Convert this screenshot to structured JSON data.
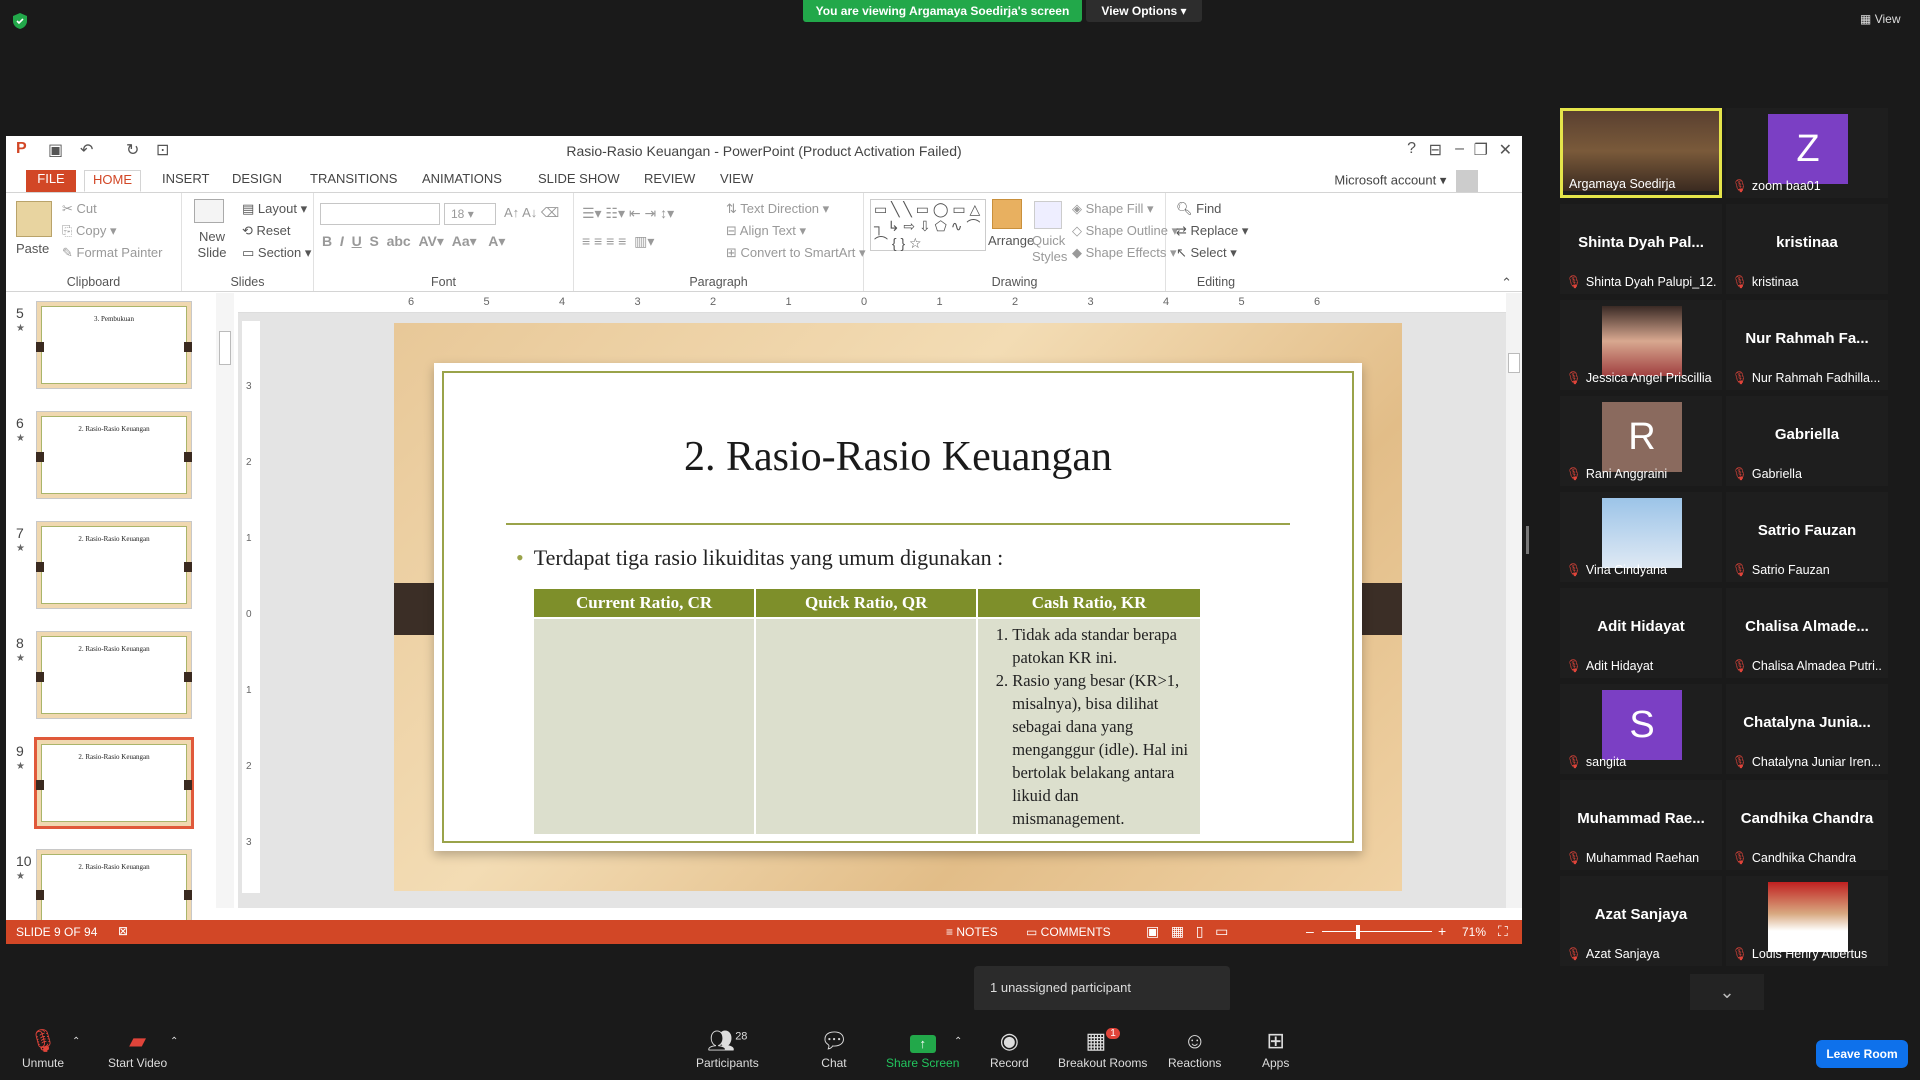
{
  "zoom": {
    "banner": "You are viewing Argamaya Soedirja's screen",
    "view_options": "View Options",
    "view": "View",
    "unassigned": "1 unassigned participant",
    "participants_count": "28",
    "toolbar": {
      "unmute": "Unmute",
      "start_video": "Start Video",
      "participants": "Participants",
      "chat": "Chat",
      "share": "Share Screen",
      "record": "Record",
      "breakout": "Breakout Rooms",
      "breakout_badge": "1",
      "reactions": "Reactions",
      "apps": "Apps",
      "leave": "Leave Room"
    },
    "colors": {
      "share": "#22a84a",
      "leave": "#0e71eb"
    }
  },
  "ppt": {
    "title": "Rasio-Rasio Keuangan - PowerPoint (Product Activation Failed)",
    "account": "Microsoft account",
    "tabs": [
      "FILE",
      "HOME",
      "INSERT",
      "DESIGN",
      "TRANSITIONS",
      "ANIMATIONS",
      "SLIDE SHOW",
      "REVIEW",
      "VIEW"
    ],
    "ribbon": {
      "clipboard": {
        "label": "Clipboard",
        "paste": "Paste",
        "cut": "Cut",
        "copy": "Copy",
        "format_painter": "Format Painter"
      },
      "slides": {
        "label": "Slides",
        "new_slide": "New Slide",
        "layout": "Layout",
        "reset": "Reset",
        "section": "Section"
      },
      "font": {
        "label": "Font",
        "size": "18"
      },
      "paragraph": {
        "label": "Paragraph",
        "text_direction": "Text Direction",
        "align_text": "Align Text",
        "convert": "Convert to SmartArt"
      },
      "drawing": {
        "label": "Drawing",
        "arrange": "Arrange",
        "quick_styles": "Quick Styles",
        "shape_fill": "Shape Fill",
        "shape_outline": "Shape Outline",
        "shape_effects": "Shape Effects"
      },
      "editing": {
        "label": "Editing",
        "find": "Find",
        "replace": "Replace",
        "select": "Select"
      }
    },
    "thumbs": [
      {
        "num": "5",
        "title": "3. Pembukuan"
      },
      {
        "num": "6",
        "title": "2. Rasio-Rasio Keuangan"
      },
      {
        "num": "7",
        "title": "2. Rasio-Rasio Keuangan"
      },
      {
        "num": "8",
        "title": "2. Rasio-Rasio Keuangan"
      },
      {
        "num": "9",
        "title": "2. Rasio-Rasio Keuangan"
      },
      {
        "num": "10",
        "title": "2. Rasio-Rasio Keuangan"
      }
    ],
    "ruler_h": [
      "6",
      "5",
      "4",
      "3",
      "2",
      "1",
      "0",
      "1",
      "2",
      "3",
      "4",
      "5",
      "6"
    ],
    "ruler_v": [
      "3",
      "2",
      "1",
      "0",
      "1",
      "2",
      "3"
    ],
    "slide": {
      "title": "2.   Rasio-Rasio Keuangan",
      "bullet": "Terdapat tiga rasio likuiditas yang umum digunakan :",
      "headers": [
        "Current Ratio, CR",
        "Quick Ratio, QR",
        "Cash Ratio, KR"
      ],
      "items": [
        "Tidak ada standar berapa patokan KR ini.",
        "Rasio yang besar (KR>1, misalnya), bisa dilihat sebagai dana yang menganggur (idle). Hal ini bertolak belakang antara likuid dan mismanagement."
      ]
    },
    "status": {
      "slide": "SLIDE 9 OF 94",
      "notes": "NOTES",
      "comments": "COMMENTS",
      "zoom": "71%"
    },
    "colors": {
      "accent": "#d24726",
      "table_header": "#7e8f2a",
      "table_cell": "#dcdfcd"
    }
  },
  "participants": [
    {
      "name": "Argamaya Soedirja",
      "display": "",
      "avatar": "video"
    },
    {
      "name": "zoom baa01",
      "display": "",
      "avatar": "Z",
      "color": "#7b3fc4"
    },
    {
      "name": "Shinta Dyah Palupi_12...",
      "display": "Shinta Dyah Pal...",
      "avatar": ""
    },
    {
      "name": "kristinaa",
      "display": "kristinaa",
      "avatar": ""
    },
    {
      "name": "Jessica Angel Priscillia",
      "display": "",
      "avatar": "photo"
    },
    {
      "name": "Nur Rahmah Fadhilla...",
      "display": "Nur Rahmah Fa...",
      "avatar": ""
    },
    {
      "name": "Rani Anggraini",
      "display": "",
      "avatar": "R",
      "color": "#8a6a5e"
    },
    {
      "name": "Gabriella",
      "display": "Gabriella",
      "avatar": ""
    },
    {
      "name": "Vina Cindyana",
      "display": "",
      "avatar": "sky"
    },
    {
      "name": "Satrio Fauzan",
      "display": "Satrio Fauzan",
      "avatar": ""
    },
    {
      "name": "Adit Hidayat",
      "display": "Adit Hidayat",
      "avatar": ""
    },
    {
      "name": "Chalisa Almadea Putri...",
      "display": "Chalisa Almade...",
      "avatar": ""
    },
    {
      "name": "sangita",
      "display": "",
      "avatar": "S",
      "color": "#7b3fc4"
    },
    {
      "name": "Chatalyna Juniar Iren...",
      "display": "Chatalyna Junia...",
      "avatar": ""
    },
    {
      "name": "Muhammad Raehan",
      "display": "Muhammad Rae...",
      "avatar": ""
    },
    {
      "name": "Candhika Chandra",
      "display": "Candhika Chandra",
      "avatar": ""
    },
    {
      "name": "Azat Sanjaya",
      "display": "Azat Sanjaya",
      "avatar": ""
    },
    {
      "name": "Louis Henry Albertus",
      "display": "",
      "avatar": "photo2"
    }
  ]
}
